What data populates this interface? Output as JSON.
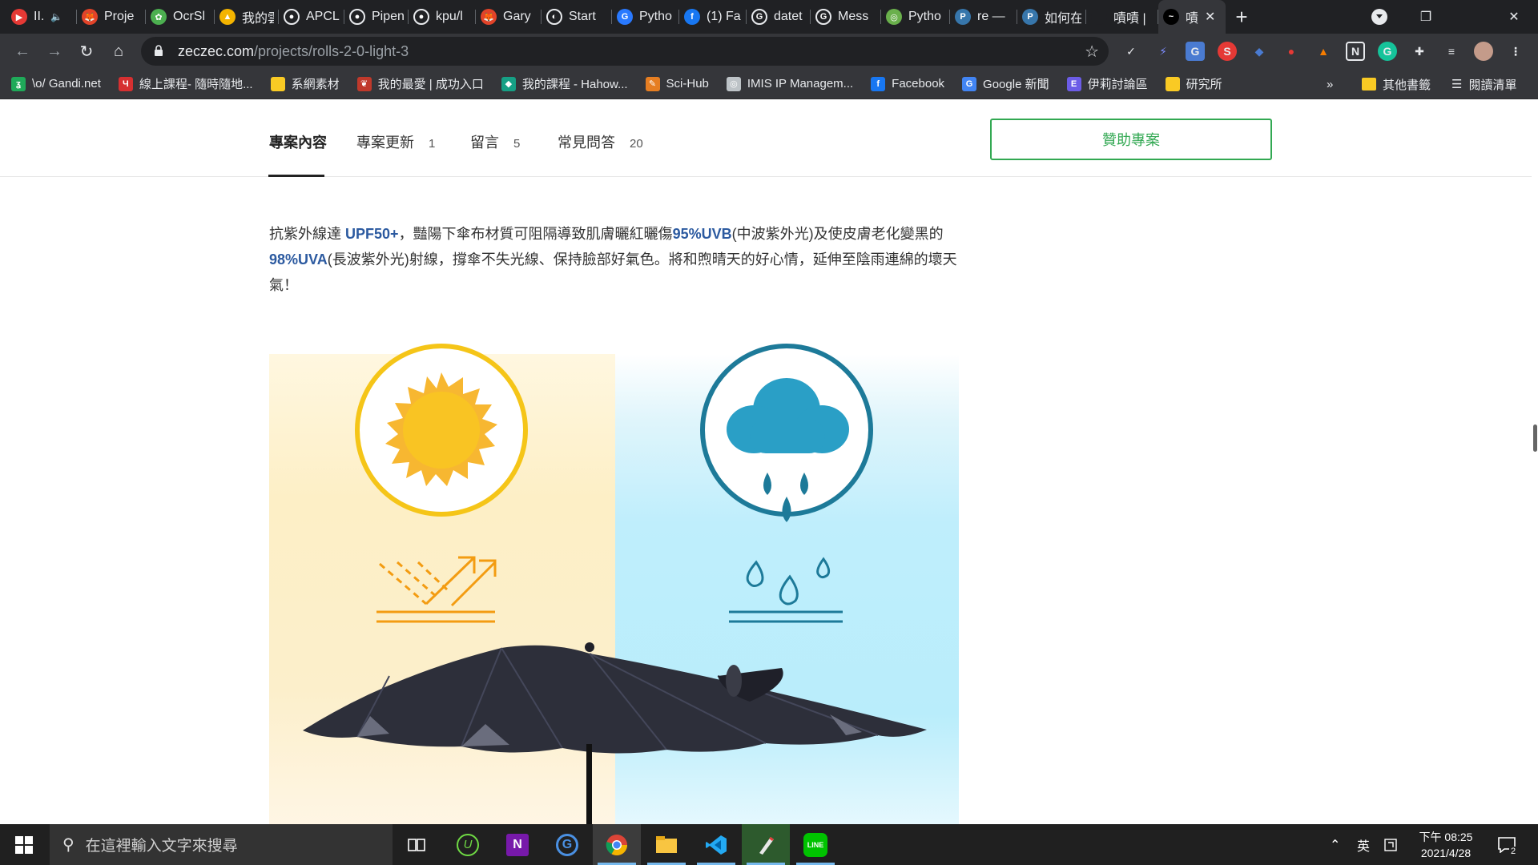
{
  "browser": {
    "tabs": [
      {
        "title": "II.",
        "favicon_color": "#e53935",
        "favicon_text": "▶",
        "audio": true
      },
      {
        "title": "Proje",
        "favicon_color": "#e24329",
        "favicon_text": "🦊"
      },
      {
        "title": "OcrSl",
        "favicon_color": "#4caf50",
        "favicon_text": "✿"
      },
      {
        "title": "我的雲",
        "favicon_color": "#f4b400",
        "favicon_text": "▲"
      },
      {
        "title": "APCL",
        "favicon_color": "#ffffff",
        "favicon_text": "●"
      },
      {
        "title": "Pipen",
        "favicon_color": "#ffffff",
        "favicon_text": "●"
      },
      {
        "title": "kpu/l",
        "favicon_color": "#ffffff",
        "favicon_text": "●"
      },
      {
        "title": "Gary",
        "favicon_color": "#e24329",
        "favicon_text": "🦊"
      },
      {
        "title": "Start",
        "favicon_color": "#ffffff",
        "favicon_text": "◐"
      },
      {
        "title": "Pytho",
        "favicon_color": "#2979ff",
        "favicon_text": "G"
      },
      {
        "title": "(1) Fa",
        "favicon_color": "#1877f2",
        "favicon_text": "f"
      },
      {
        "title": "datet",
        "favicon_color": "#ffffff",
        "favicon_text": "G"
      },
      {
        "title": "Mess",
        "favicon_color": "#ffffff",
        "favicon_text": "G"
      },
      {
        "title": "Pytho",
        "favicon_color": "#6ab04c",
        "favicon_text": "◎"
      },
      {
        "title": "re —",
        "favicon_color": "#3776ab",
        "favicon_text": "P"
      },
      {
        "title": "如何在",
        "favicon_color": "#3776ab",
        "favicon_text": "P"
      },
      {
        "title": "嘖嘖 |",
        "favicon_color": "#202124",
        "favicon_text": ""
      },
      {
        "title": "嘖",
        "favicon_color": "#000000",
        "favicon_text": "~",
        "active": true
      }
    ],
    "new_tab_symbol": "+",
    "window_controls": {
      "minimize": "—",
      "restore": "❐",
      "close": "✕"
    },
    "url_host": "zeczec.com",
    "url_path": "/projects/rolls-2-0-light-3",
    "bookmarks": [
      {
        "label": "\\o/ Gandi.net",
        "icon_color": "#1faa59",
        "icon_text": "ʓ"
      },
      {
        "label": "線上課程- 隨時隨地...",
        "icon_color": "#d63031",
        "icon_text": "Ч"
      },
      {
        "label": "系網素材",
        "icon_color": "#f9ca24",
        "icon_text": ""
      },
      {
        "label": "我的最愛 | 成功入口",
        "icon_color": "#c0392b",
        "icon_text": "❦"
      },
      {
        "label": "我的課程 - Hahow...",
        "icon_color": "#16a085",
        "icon_text": "◆"
      },
      {
        "label": "Sci-Hub",
        "icon_color": "#e67e22",
        "icon_text": "✎"
      },
      {
        "label": "IMIS IP Managem...",
        "icon_color": "#bdc3c7",
        "icon_text": "◎"
      },
      {
        "label": "Facebook",
        "icon_color": "#1877f2",
        "icon_text": "f"
      },
      {
        "label": "Google 新聞",
        "icon_color": "#4285f4",
        "icon_text": "G"
      },
      {
        "label": "伊莉討論區",
        "icon_color": "#6c5ce7",
        "icon_text": "E"
      },
      {
        "label": "研究所",
        "icon_color": "#f9ca24",
        "icon_text": ""
      }
    ],
    "bookmarks_overflow": "»",
    "other_bookmarks": "其他書籤",
    "reading_list": "閱讀清單"
  },
  "page": {
    "subnav": {
      "tabs": [
        {
          "label": "專案內容",
          "count": ""
        },
        {
          "label": "專案更新",
          "count": "1"
        },
        {
          "label": "留言",
          "count": "5"
        },
        {
          "label": "常見問答",
          "count": "20"
        }
      ],
      "back_button": "贊助專案"
    },
    "description": {
      "p1": "抗紫外線達 ",
      "upf": "UPF50+",
      "p2": "，豔陽下傘布材質可阻隔導致肌膚曬紅曬傷",
      "uvb": "95%UVB",
      "p3": "(中波紫外光)及使皮膚老化變黑的",
      "uva": "98%UVA",
      "p4": "(長波紫外光)射線，撐傘不失光線、保持臉部好氣色。將和煦晴天的好心情，延伸至陰雨連綿的壞天氣！"
    },
    "colors": {
      "sun": "#f7c325",
      "sun_ring": "#f5c518",
      "rain": "#2a9fc6",
      "rain_ring": "#1d7a99",
      "uv_lines": "#f39c12",
      "drop": "#1d7a99",
      "umbrella": "#2d2f3a"
    }
  },
  "taskbar": {
    "search_placeholder": "在這裡輸入文字來搜尋",
    "apps": [
      "task-view",
      "upwork",
      "onenote",
      "grammarly",
      "chrome",
      "file-explorer",
      "vscode",
      "pen-app",
      "line"
    ],
    "tray_ime": "英",
    "time": "下午 08:25",
    "date": "2021/4/28",
    "notification_count": "2"
  }
}
